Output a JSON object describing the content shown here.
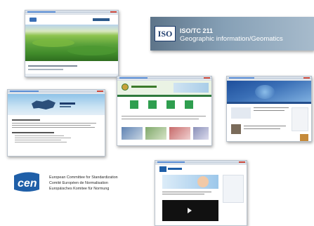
{
  "screenshots": [
    {
      "id": "inspire",
      "site": "Geoportal with green field landscape"
    },
    {
      "id": "kazakhstan",
      "site": "Map portal"
    },
    {
      "id": "belarus",
      "site": "Government geodata portal"
    },
    {
      "id": "blue-portal",
      "site": "Geodata news portal"
    },
    {
      "id": "cen-portal",
      "site": "Standards portal"
    }
  ],
  "iso_banner": {
    "logo_text": "ISO",
    "title": "ISO/TC 211",
    "subtitle": "Geographic information/Geomatics"
  },
  "cen": {
    "mark_text": "cen",
    "line1": "European Committee for Standardization",
    "line2": "Comité Européen de Normalisation",
    "line3": "Europäisches Komitee für Normung"
  },
  "colors": {
    "browser_chrome": "#c4cfdc",
    "iso_banner": "#86a0b6",
    "cen_blue": "#1f5fa8",
    "grass_green": "#5aa13a",
    "sky_blue": "#3a6fb6"
  }
}
